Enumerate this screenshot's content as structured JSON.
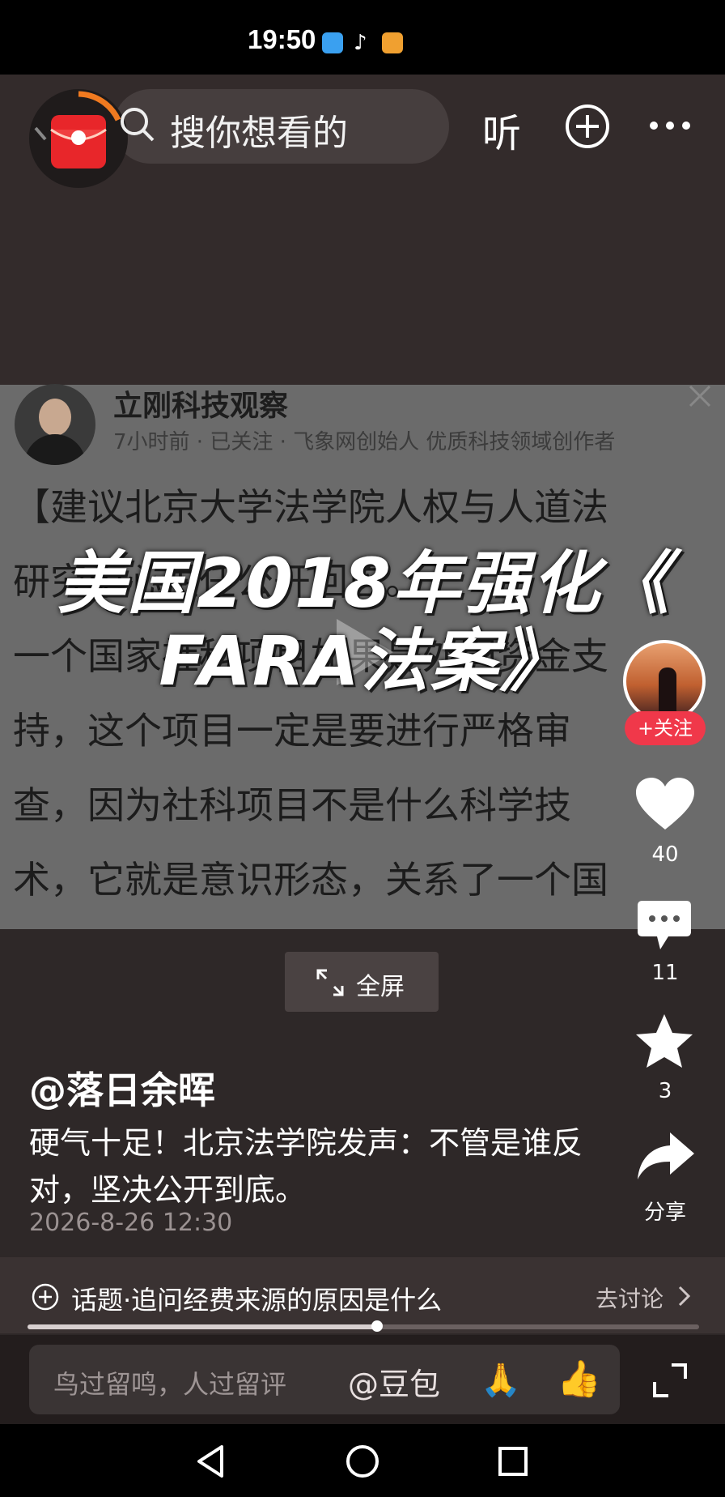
{
  "status_bar": {
    "time": "19:50"
  },
  "top_bar": {
    "search_placeholder": "搜你想看的",
    "listen_label": "听"
  },
  "video": {
    "card_author": "立刚科技观察",
    "card_meta": "7小时前 · 已关注 · 飞象网创始人 优质科技领域创作者",
    "article_lines": [
      "【建议北京大学法学院人权与人道法",
      "研究中心主任公开回应。",
      "一个国家社科项目如果是外国资金支",
      "持，这个项目一定是要进行严格审",
      "查，因为社科项目不是什么科学技",
      "术，它就是意识形态，关系了一个国"
    ],
    "overlay_title_line1": "美国2018年强化《",
    "overlay_title_line2": "FARA法案》",
    "fullscreen_label": "全屏"
  },
  "right_rail": {
    "follow_label": "+关注",
    "likes": "40",
    "comments": "11",
    "favorites": "3",
    "share_label": "分享"
  },
  "post": {
    "author": "@落日余晖",
    "caption": "硬气十足！北京法学院发声：不管是谁反对，坚决公开到底。",
    "date": "2026-8-26 12:30"
  },
  "topic_bar": {
    "topic": "话题·追问经费来源的原因是什么",
    "discuss_label": "去讨论"
  },
  "progress": {
    "fraction": 0.52
  },
  "comment_bar": {
    "placeholder": "鸟过留鸣，人过留评",
    "mention": "@豆包"
  },
  "colors": {
    "follow_red": "#f0384a",
    "background": "#2e2828"
  }
}
